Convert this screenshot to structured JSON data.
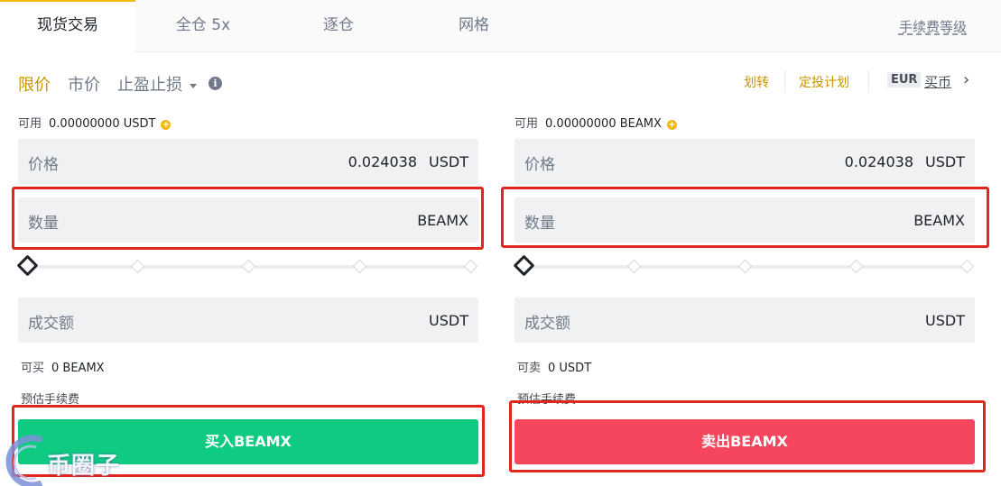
{
  "tabs": {
    "spot": "现货交易",
    "cross": "全仓 5x",
    "isolated": "逐仓",
    "grid": "网格",
    "fee_level": "手续费等级"
  },
  "order_types": {
    "limit": "限价",
    "market": "市价",
    "stop_limit": "止盈止损"
  },
  "links": {
    "transfer": "划转",
    "recurring": "定投计划",
    "currency": "EUR",
    "buy_crypto": "买币"
  },
  "buy_panel": {
    "available_label": "可用",
    "available_value": "0.00000000 USDT",
    "price_label": "价格",
    "price_value": "0.024038",
    "price_unit": "USDT",
    "amount_label": "数量",
    "amount_unit": "BEAMX",
    "slider_percent": 0,
    "total_label": "成交额",
    "total_unit": "USDT",
    "max_label": "可买",
    "max_value": "0 BEAMX",
    "fee_label": "预估手续费",
    "button": "买入BEAMX"
  },
  "sell_panel": {
    "available_label": "可用",
    "available_value": "0.00000000 BEAMX",
    "price_label": "价格",
    "price_value": "0.024038",
    "price_unit": "USDT",
    "amount_label": "数量",
    "amount_unit": "BEAMX",
    "slider_percent": 0,
    "total_label": "成交额",
    "total_unit": "USDT",
    "max_label": "可卖",
    "max_value": "0 USDT",
    "fee_label": "预估手续费",
    "button": "卖出BEAMX"
  },
  "watermark": "币圈子",
  "colors": {
    "accent": "#f0b90b",
    "buy": "#0ecb81",
    "sell": "#f6465d",
    "highlight": "#e0261e"
  }
}
